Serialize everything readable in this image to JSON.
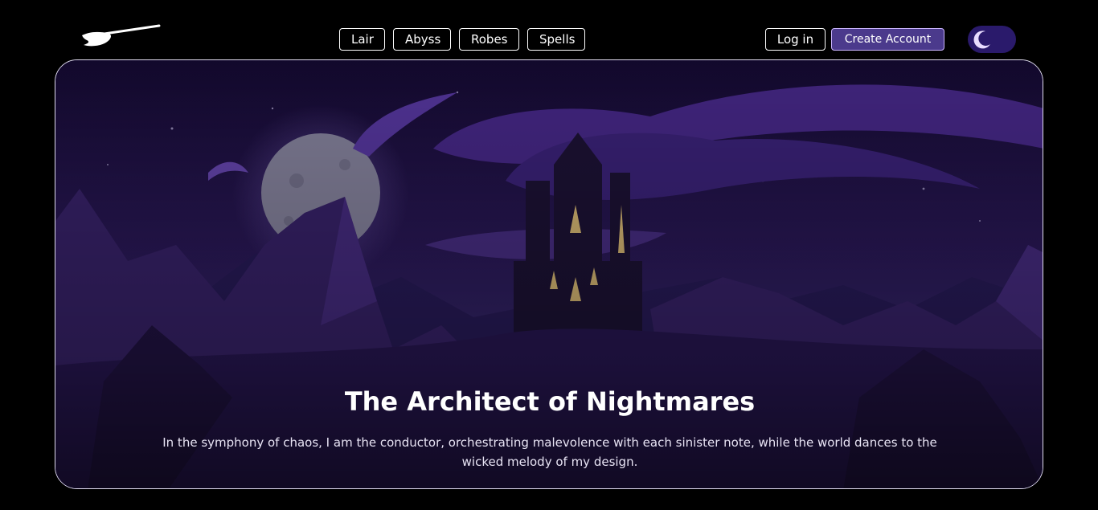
{
  "header": {
    "logo_icon": "broom-icon",
    "nav": [
      {
        "label": "Lair"
      },
      {
        "label": "Abyss"
      },
      {
        "label": "Robes"
      },
      {
        "label": "Spells"
      }
    ],
    "login_label": "Log in",
    "create_account_label": "Create Account",
    "theme_toggle_icon": "moon-icon"
  },
  "hero": {
    "title": "The Architect of Nightmares",
    "subtitle": "In the symphony of chaos, I am the conductor, orchestrating malevolence with each sinister note, while the world dances to the wicked melody of my design."
  },
  "colors": {
    "background": "#000000",
    "accent": "#4b3a8c",
    "toggle": "#2a1a6b",
    "sky": "#2d1a5e",
    "mountains": "#3b2470"
  }
}
